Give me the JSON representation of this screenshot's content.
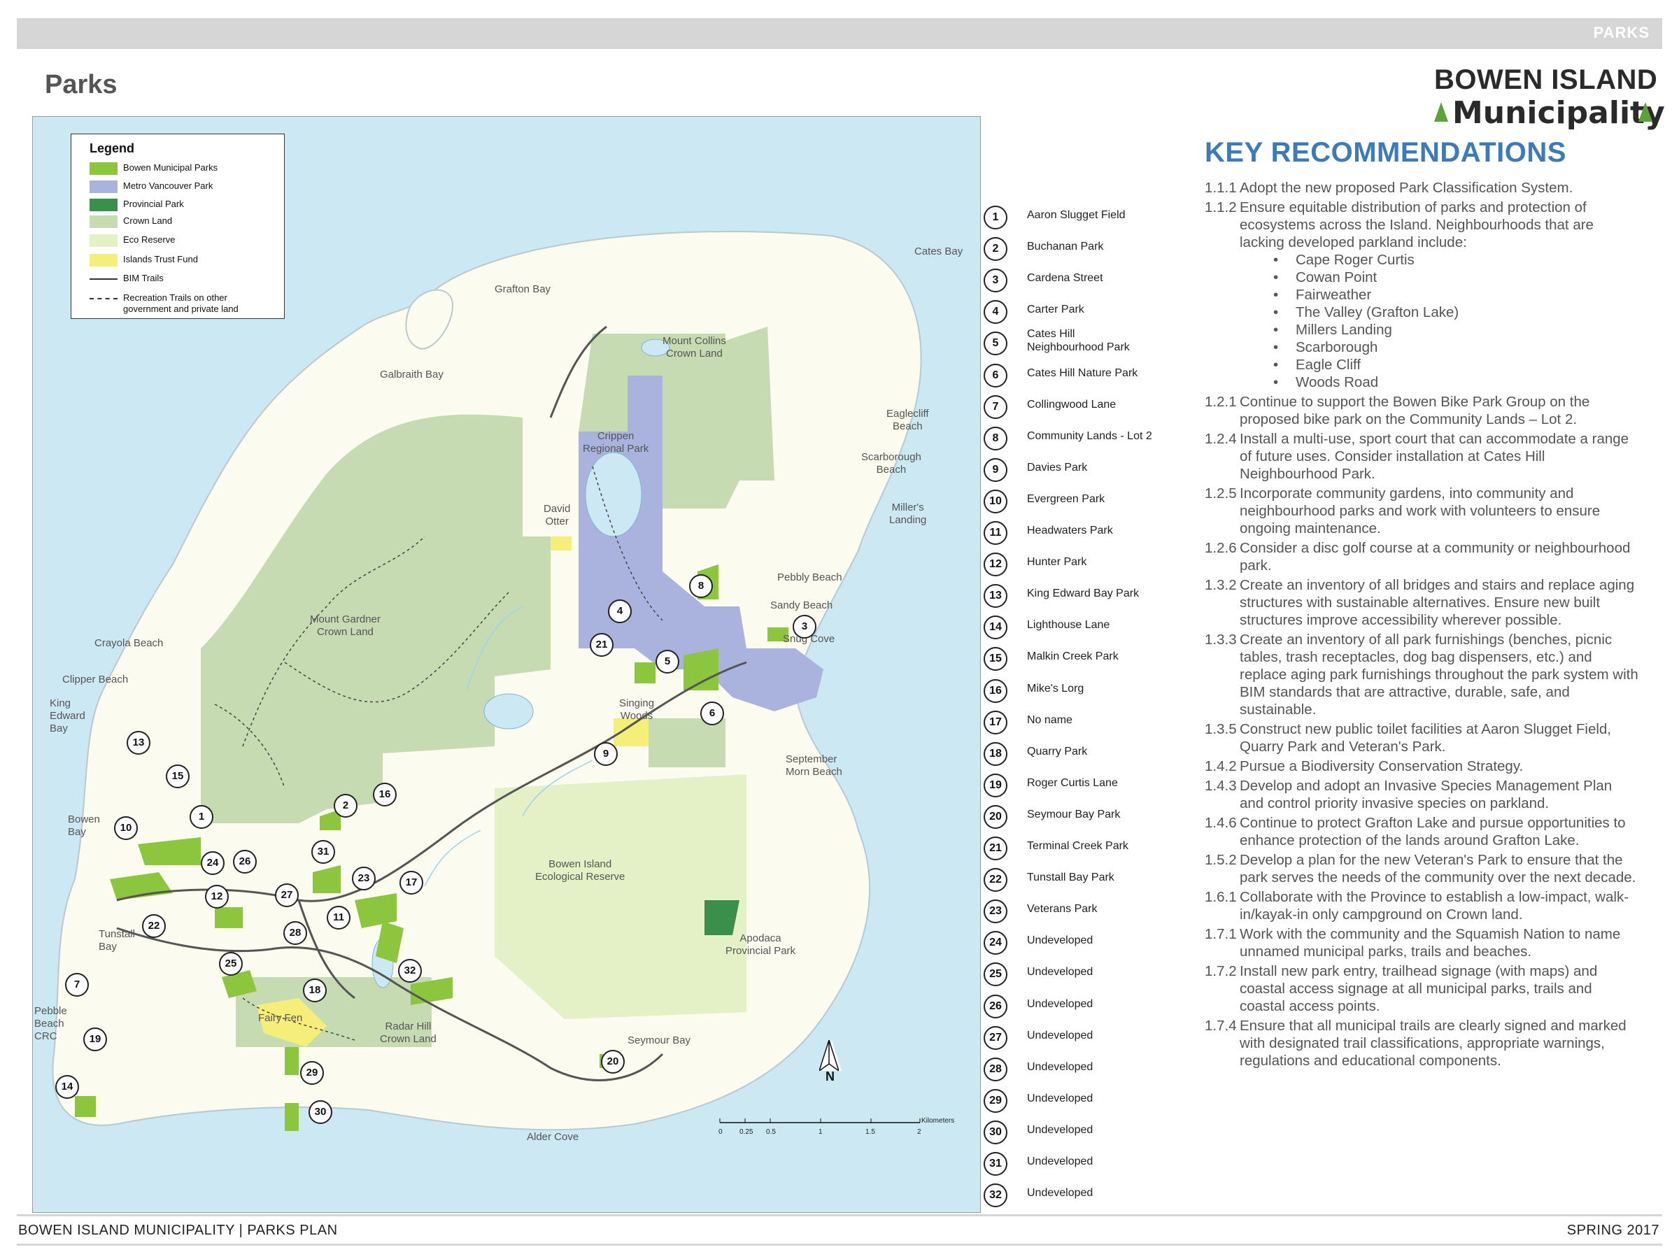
{
  "header": {
    "section_label": "PARKS",
    "page_title": "Parks"
  },
  "logo": {
    "line1": "BOWEN ISLAND",
    "line2": "Municipality"
  },
  "colors": {
    "bowen_municipal_parks": "#8cc63f",
    "metro_vancouver_park": "#a9b3dd",
    "provincial_park": "#3a8f4a",
    "crown_land": "#c6dbb2",
    "eco_reserve": "#e4f0c6",
    "islands_trust_fund": "#f5ef7a",
    "water": "#cbe8f3",
    "land": "#fbfbef",
    "accent_blue": "#3d7ab8"
  },
  "legend": {
    "title": "Legend",
    "items": [
      {
        "label": "Bowen Municipal Parks",
        "color": "#8cc63f",
        "kind": "fill"
      },
      {
        "label": "Metro Vancouver Park",
        "color": "#a9b3dd",
        "kind": "fill"
      },
      {
        "label": "Provincial Park",
        "color": "#3a8f4a",
        "kind": "fill"
      },
      {
        "label": "Crown Land",
        "color": "#c6dbb2",
        "kind": "fill"
      },
      {
        "label": "Eco Reserve",
        "color": "#e4f0c6",
        "kind": "fill"
      },
      {
        "label": "Islands Trust Fund",
        "color": "#f5ef7a",
        "kind": "fill"
      },
      {
        "label": "BIM Trails",
        "color": "#333333",
        "kind": "line"
      },
      {
        "label": "Recreation Trails on other government and private land",
        "color": "#333333",
        "kind": "dash"
      }
    ]
  },
  "map_labels": {
    "cates_bay": "Cates Bay",
    "grafton_bay": "Grafton Bay",
    "mount_collins": "Mount Collins\nCrown Land",
    "galbraith_bay": "Galbraith Bay",
    "eaglecliff_beach": "Eaglecliff\nBeach",
    "scarborough_beach": "Scarborough\nBeach",
    "crippen": "Crippen\nRegional Park",
    "millers_landing": "Miller's\nLanding",
    "david_otter": "David\nOtter",
    "pebbly_beach": "Pebbly Beach",
    "sandy_beach": "Sandy Beach",
    "snug_cove": "Snug Cove",
    "mount_gardner": "Mount Gardner\nCrown Land",
    "crayola_beach": "Crayola Beach",
    "clipper_beach": "Clipper Beach",
    "king_edward_bay": "King\nEdward\nBay",
    "singing_woods": "Singing\nWoods",
    "september_morn": "September\nMorn Beach",
    "bowen_bay": "Bowen\nBay",
    "eco_reserve_label": "Bowen Island\nEcological Reserve",
    "tunstall_bay": "Tunstall\nBay",
    "apodaca": "Apodaca\nProvincial Park",
    "pebble_beach": "Pebble\nBeach\nCRC",
    "fairy_fen": "Fairy Fen",
    "radar_hill": "Radar Hill\nCrown Land",
    "seymour_bay": "Seymour Bay",
    "alder_cove": "Alder Cove",
    "north": "N"
  },
  "scale": {
    "ticks": [
      "0",
      "0.25",
      "0.5",
      "1",
      "1.5",
      "2"
    ],
    "unit": "Kilometers"
  },
  "map_pins": [
    "13",
    "15",
    "1",
    "10",
    "24",
    "26",
    "12",
    "27",
    "22",
    "25",
    "7",
    "19",
    "14",
    "28",
    "11",
    "18",
    "29",
    "30",
    "2",
    "16",
    "31",
    "23",
    "17",
    "32",
    "20",
    "4",
    "21",
    "5",
    "6",
    "9",
    "8",
    "3"
  ],
  "park_index": [
    {
      "num": "1",
      "name": "Aaron Slugget Field"
    },
    {
      "num": "2",
      "name": "Buchanan Park"
    },
    {
      "num": "3",
      "name": "Cardena Street"
    },
    {
      "num": "4",
      "name": "Carter Park"
    },
    {
      "num": "5",
      "name": "Cates Hill\nNeighbourhood Park"
    },
    {
      "num": "6",
      "name": "Cates Hill Nature Park"
    },
    {
      "num": "7",
      "name": "Collingwood Lane"
    },
    {
      "num": "8",
      "name": "Community Lands - Lot 2"
    },
    {
      "num": "9",
      "name": "Davies Park"
    },
    {
      "num": "10",
      "name": "Evergreen Park"
    },
    {
      "num": "11",
      "name": "Headwaters Park"
    },
    {
      "num": "12",
      "name": "Hunter Park"
    },
    {
      "num": "13",
      "name": "King Edward Bay Park"
    },
    {
      "num": "14",
      "name": "Lighthouse Lane"
    },
    {
      "num": "15",
      "name": "Malkin Creek Park"
    },
    {
      "num": "16",
      "name": "Mike's Lorg"
    },
    {
      "num": "17",
      "name": "No name"
    },
    {
      "num": "18",
      "name": "Quarry Park"
    },
    {
      "num": "19",
      "name": "Roger Curtis Lane"
    },
    {
      "num": "20",
      "name": "Seymour Bay Park"
    },
    {
      "num": "21",
      "name": "Terminal Creek Park"
    },
    {
      "num": "22",
      "name": "Tunstall Bay Park"
    },
    {
      "num": "23",
      "name": "Veterans Park"
    },
    {
      "num": "24",
      "name": "Undeveloped"
    },
    {
      "num": "25",
      "name": "Undeveloped"
    },
    {
      "num": "26",
      "name": "Undeveloped"
    },
    {
      "num": "27",
      "name": "Undeveloped"
    },
    {
      "num": "28",
      "name": "Undeveloped"
    },
    {
      "num": "29",
      "name": "Undeveloped"
    },
    {
      "num": "30",
      "name": "Undeveloped"
    },
    {
      "num": "31",
      "name": "Undeveloped"
    },
    {
      "num": "32",
      "name": "Undeveloped"
    }
  ],
  "key_recommendations": {
    "title": "KEY RECOMMENDATIONS",
    "items": [
      {
        "num": "1.1.1",
        "text": "Adopt the new proposed Park Classification System."
      },
      {
        "num": "1.1.2",
        "text": "Ensure equitable distribution of parks and protection of ecosystems across the Island. Neighbourhoods that are lacking developed parkland include:",
        "bullets": [
          "Cape Roger Curtis",
          "Cowan Point",
          "Fairweather",
          "The Valley (Grafton Lake)",
          "Millers Landing",
          "Scarborough",
          "Eagle Cliff",
          "Woods Road"
        ]
      },
      {
        "num": "1.2.1",
        "text": "Continue to support the Bowen Bike Park Group on the proposed bike park on the Community Lands – Lot 2."
      },
      {
        "num": "1.2.4",
        "text": "Install a multi-use, sport court that can accommodate a range of future uses. Consider installation at Cates Hill Neighbourhood Park."
      },
      {
        "num": "1.2.5",
        "text": "Incorporate community gardens, into community and neighbourhood parks and work with volunteers to ensure ongoing maintenance."
      },
      {
        "num": "1.2.6",
        "text": "Consider a disc golf course at a community or neighbourhood park."
      },
      {
        "num": "1.3.2",
        "text": "Create an inventory of all bridges and stairs and replace aging structures with sustainable alternatives. Ensure new built structures improve accessibility wherever possible."
      },
      {
        "num": "1.3.3",
        "text": "Create an inventory of all park furnishings (benches, picnic tables, trash receptacles, dog bag dispensers, etc.) and replace aging park furnishings throughout the park system with BIM standards that are attractive, durable, safe, and sustainable."
      },
      {
        "num": "1.3.5",
        "text": "Construct new public toilet facilities at Aaron Slugget Field, Quarry Park and Veteran's Park."
      },
      {
        "num": "1.4.2",
        "text": "Pursue a Biodiversity Conservation Strategy."
      },
      {
        "num": "1.4.3",
        "text": "Develop and adopt an Invasive Species Management Plan and control priority invasive species on parkland."
      },
      {
        "num": "1.4.6",
        "text": "Continue to protect Grafton Lake and pursue opportunities to enhance protection of the lands around Grafton Lake."
      },
      {
        "num": "1.5.2",
        "text": "Develop a plan for the new Veteran's Park to ensure that the park serves the needs of the community over the next decade."
      },
      {
        "num": "1.6.1",
        "text": "Collaborate with the Province to establish a low-impact, walk-in/kayak-in only campground on Crown land."
      },
      {
        "num": "1.7.1",
        "text": "Work with the community and the Squamish Nation to name unnamed municipal parks, trails and beaches."
      },
      {
        "num": "1.7.2",
        "text": "Install new park entry, trailhead signage (with maps) and coastal access signage at all municipal parks, trails and coastal access points."
      },
      {
        "num": "1.7.4",
        "text": "Ensure that all municipal trails are clearly signed and marked with designated trail classifications, appropriate warnings, regulations and educational components."
      }
    ]
  },
  "footer": {
    "left": "BOWEN ISLAND MUNICIPALITY | PARKS PLAN",
    "right": "SPRING 2017"
  }
}
